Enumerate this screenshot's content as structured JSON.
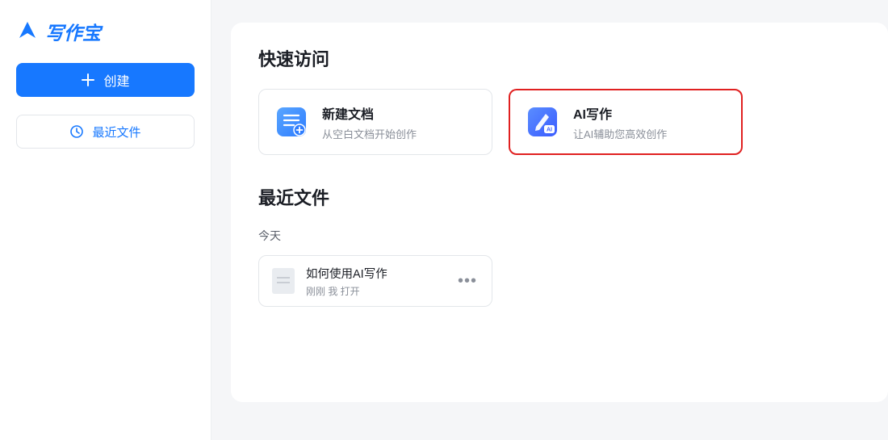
{
  "app": {
    "name": "写作宝"
  },
  "sidebar": {
    "create_label": "创建",
    "recent_files_label": "最近文件"
  },
  "main": {
    "quick_access_title": "快速访问",
    "cards": [
      {
        "title": "新建文档",
        "subtitle": "从空白文档开始创作",
        "icon": "new-doc-icon",
        "highlight": false
      },
      {
        "title": "AI写作",
        "subtitle": "让AI辅助您高效创作",
        "icon": "ai-write-icon",
        "highlight": true
      }
    ],
    "recent_section_title": "最近文件",
    "recent_group_label": "今天",
    "recent_files": [
      {
        "title": "如何使用AI写作",
        "subtitle": "刚刚 我 打开"
      }
    ]
  }
}
